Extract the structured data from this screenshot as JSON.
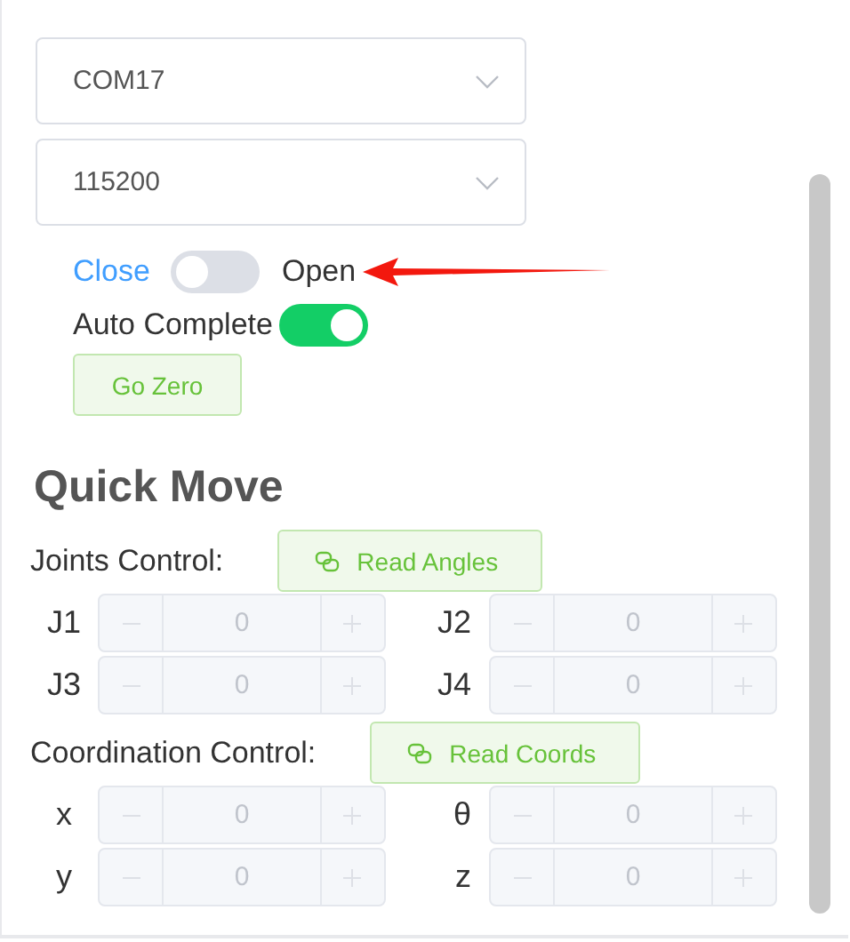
{
  "selects": [
    {
      "value": "COM17"
    },
    {
      "value": "115200"
    }
  ],
  "connection": {
    "off_label": "Close",
    "on_label": "Open",
    "on": false
  },
  "auto_complete": {
    "label": "Auto Complete",
    "on": true
  },
  "go_zero": "Go Zero",
  "quick_move": {
    "title": "Quick Move",
    "groups": [
      {
        "label": "Joints Control:",
        "button": "Read Angles",
        "inputs": [
          {
            "label": "J1",
            "value": "0",
            "disabled": true
          },
          {
            "label": "J2",
            "value": "0",
            "disabled": true
          },
          {
            "label": "J3",
            "value": "0",
            "disabled": true
          },
          {
            "label": "J4",
            "value": "0",
            "disabled": true
          }
        ]
      },
      {
        "label": "Coordination Control:",
        "button": "Read Coords",
        "inputs": [
          {
            "label": "x",
            "value": "0",
            "disabled": true
          },
          {
            "label": "θ",
            "value": "0",
            "disabled": true
          },
          {
            "label": "y",
            "value": "0",
            "disabled": true
          },
          {
            "label": "z",
            "value": "0",
            "disabled": true
          }
        ]
      }
    ]
  }
}
